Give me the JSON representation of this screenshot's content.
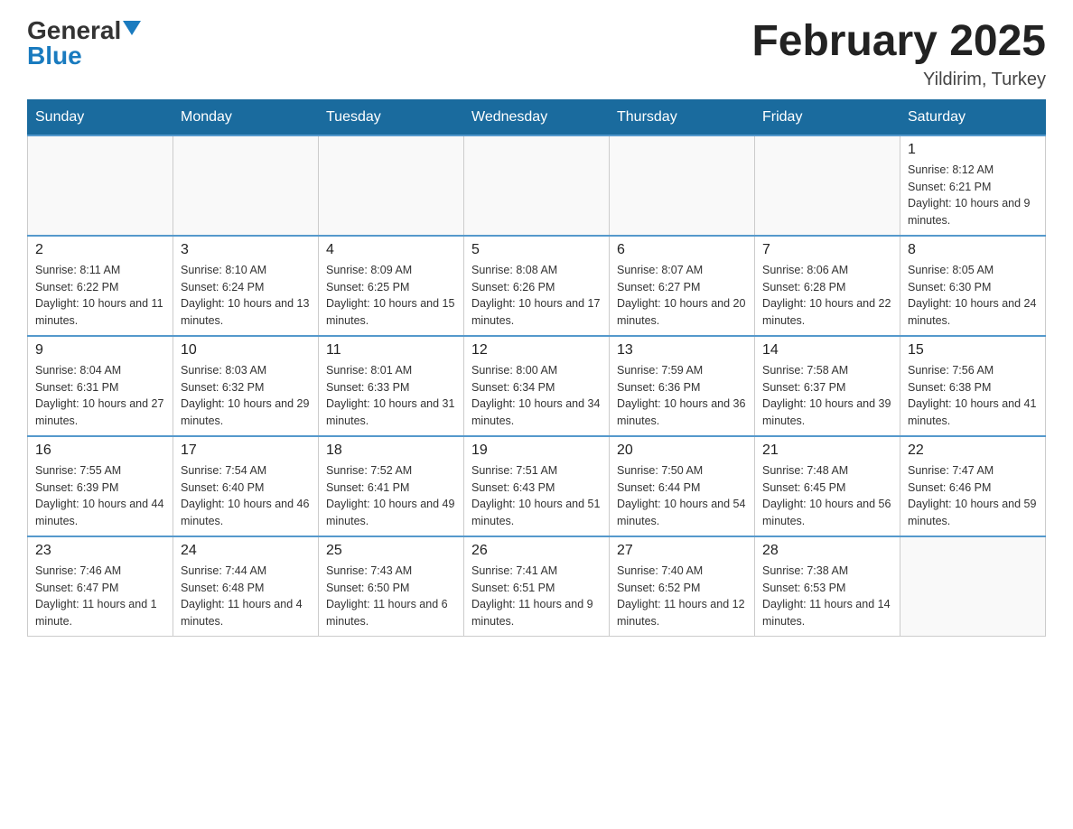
{
  "logo": {
    "general": "General",
    "blue": "Blue"
  },
  "header": {
    "month_title": "February 2025",
    "location": "Yildirim, Turkey"
  },
  "days_of_week": [
    "Sunday",
    "Monday",
    "Tuesday",
    "Wednesday",
    "Thursday",
    "Friday",
    "Saturday"
  ],
  "weeks": [
    [
      {
        "day": "",
        "info": ""
      },
      {
        "day": "",
        "info": ""
      },
      {
        "day": "",
        "info": ""
      },
      {
        "day": "",
        "info": ""
      },
      {
        "day": "",
        "info": ""
      },
      {
        "day": "",
        "info": ""
      },
      {
        "day": "1",
        "info": "Sunrise: 8:12 AM\nSunset: 6:21 PM\nDaylight: 10 hours and 9 minutes."
      }
    ],
    [
      {
        "day": "2",
        "info": "Sunrise: 8:11 AM\nSunset: 6:22 PM\nDaylight: 10 hours and 11 minutes."
      },
      {
        "day": "3",
        "info": "Sunrise: 8:10 AM\nSunset: 6:24 PM\nDaylight: 10 hours and 13 minutes."
      },
      {
        "day": "4",
        "info": "Sunrise: 8:09 AM\nSunset: 6:25 PM\nDaylight: 10 hours and 15 minutes."
      },
      {
        "day": "5",
        "info": "Sunrise: 8:08 AM\nSunset: 6:26 PM\nDaylight: 10 hours and 17 minutes."
      },
      {
        "day": "6",
        "info": "Sunrise: 8:07 AM\nSunset: 6:27 PM\nDaylight: 10 hours and 20 minutes."
      },
      {
        "day": "7",
        "info": "Sunrise: 8:06 AM\nSunset: 6:28 PM\nDaylight: 10 hours and 22 minutes."
      },
      {
        "day": "8",
        "info": "Sunrise: 8:05 AM\nSunset: 6:30 PM\nDaylight: 10 hours and 24 minutes."
      }
    ],
    [
      {
        "day": "9",
        "info": "Sunrise: 8:04 AM\nSunset: 6:31 PM\nDaylight: 10 hours and 27 minutes."
      },
      {
        "day": "10",
        "info": "Sunrise: 8:03 AM\nSunset: 6:32 PM\nDaylight: 10 hours and 29 minutes."
      },
      {
        "day": "11",
        "info": "Sunrise: 8:01 AM\nSunset: 6:33 PM\nDaylight: 10 hours and 31 minutes."
      },
      {
        "day": "12",
        "info": "Sunrise: 8:00 AM\nSunset: 6:34 PM\nDaylight: 10 hours and 34 minutes."
      },
      {
        "day": "13",
        "info": "Sunrise: 7:59 AM\nSunset: 6:36 PM\nDaylight: 10 hours and 36 minutes."
      },
      {
        "day": "14",
        "info": "Sunrise: 7:58 AM\nSunset: 6:37 PM\nDaylight: 10 hours and 39 minutes."
      },
      {
        "day": "15",
        "info": "Sunrise: 7:56 AM\nSunset: 6:38 PM\nDaylight: 10 hours and 41 minutes."
      }
    ],
    [
      {
        "day": "16",
        "info": "Sunrise: 7:55 AM\nSunset: 6:39 PM\nDaylight: 10 hours and 44 minutes."
      },
      {
        "day": "17",
        "info": "Sunrise: 7:54 AM\nSunset: 6:40 PM\nDaylight: 10 hours and 46 minutes."
      },
      {
        "day": "18",
        "info": "Sunrise: 7:52 AM\nSunset: 6:41 PM\nDaylight: 10 hours and 49 minutes."
      },
      {
        "day": "19",
        "info": "Sunrise: 7:51 AM\nSunset: 6:43 PM\nDaylight: 10 hours and 51 minutes."
      },
      {
        "day": "20",
        "info": "Sunrise: 7:50 AM\nSunset: 6:44 PM\nDaylight: 10 hours and 54 minutes."
      },
      {
        "day": "21",
        "info": "Sunrise: 7:48 AM\nSunset: 6:45 PM\nDaylight: 10 hours and 56 minutes."
      },
      {
        "day": "22",
        "info": "Sunrise: 7:47 AM\nSunset: 6:46 PM\nDaylight: 10 hours and 59 minutes."
      }
    ],
    [
      {
        "day": "23",
        "info": "Sunrise: 7:46 AM\nSunset: 6:47 PM\nDaylight: 11 hours and 1 minute."
      },
      {
        "day": "24",
        "info": "Sunrise: 7:44 AM\nSunset: 6:48 PM\nDaylight: 11 hours and 4 minutes."
      },
      {
        "day": "25",
        "info": "Sunrise: 7:43 AM\nSunset: 6:50 PM\nDaylight: 11 hours and 6 minutes."
      },
      {
        "day": "26",
        "info": "Sunrise: 7:41 AM\nSunset: 6:51 PM\nDaylight: 11 hours and 9 minutes."
      },
      {
        "day": "27",
        "info": "Sunrise: 7:40 AM\nSunset: 6:52 PM\nDaylight: 11 hours and 12 minutes."
      },
      {
        "day": "28",
        "info": "Sunrise: 7:38 AM\nSunset: 6:53 PM\nDaylight: 11 hours and 14 minutes."
      },
      {
        "day": "",
        "info": ""
      }
    ]
  ]
}
